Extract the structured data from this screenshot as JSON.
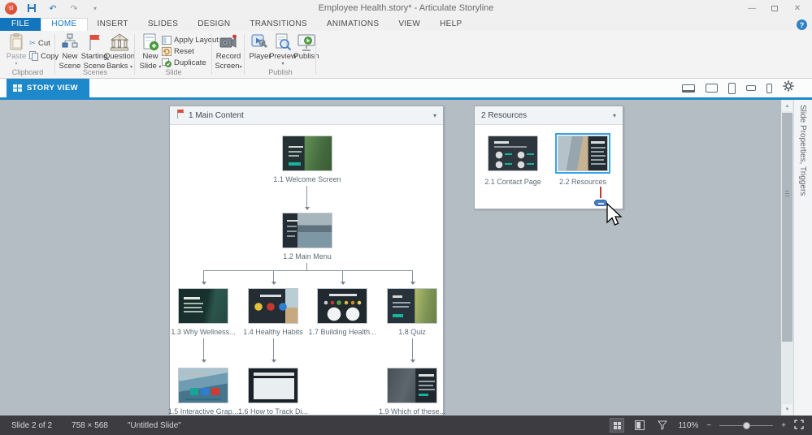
{
  "title_bar": {
    "title": "Employee Health.story* - Articulate Storyline"
  },
  "tabs": {
    "file": "FILE",
    "home": "HOME",
    "insert": "INSERT",
    "slides": "SLIDES",
    "design": "DESIGN",
    "transitions": "TRANSITIONS",
    "animations": "ANIMATIONS",
    "view": "VIEW",
    "help": "HELP"
  },
  "ribbon": {
    "paste": "Paste",
    "cut": "Cut",
    "copy": "Copy",
    "clipboard_group": "Clipboard",
    "new_scene": [
      "New",
      "Scene"
    ],
    "starting_scene": [
      "Starting",
      "Scene"
    ],
    "question_banks": [
      "Question",
      "Banks"
    ],
    "scenes_group": "Scenes",
    "new_slide": [
      "New",
      "Slide"
    ],
    "apply_layout": "Apply Layout",
    "reset": "Reset",
    "duplicate": "Duplicate",
    "record_screen": [
      "Record",
      "Screen"
    ],
    "slide_group": "Slide",
    "player": "Player",
    "preview": "Preview",
    "publish": "Publish",
    "publish_group": "Publish"
  },
  "view_tab": {
    "label": "STORY VIEW"
  },
  "scenes": [
    {
      "title": "1 Main Content",
      "slides": [
        {
          "label": "1.1 Welcome Screen"
        },
        {
          "label": "1.2 Main Menu"
        },
        {
          "label": "1.3 Why Wellness..."
        },
        {
          "label": "1.4 Healthy Habits"
        },
        {
          "label": "1.7 Building Health..."
        },
        {
          "label": "1.8 Quiz"
        },
        {
          "label": "1.5 Interactive Grap..."
        },
        {
          "label": "1.6 How to Track Di..."
        },
        {
          "label": "1.9 Which of these..."
        }
      ]
    },
    {
      "title": "2 Resources",
      "slides": [
        {
          "label": "2.1 Contact Page"
        },
        {
          "label": "2.2 Resources"
        }
      ]
    }
  ],
  "sidebar": {
    "label": "Slide Properties, Triggers"
  },
  "status_bar": {
    "slide_position": "Slide 2 of 2",
    "dimensions": "758 × 568",
    "slide_name": "\"Untitled Slide\"",
    "zoom_level": "110%"
  },
  "icons": {
    "help": "?",
    "chevron_down": "▾",
    "scroll_up": "▲",
    "scroll_down": "▼",
    "minimize": "—",
    "close": "✕",
    "cut_glyph": "✂"
  },
  "colors": {
    "accent": "#1d88ca",
    "selection": "#35a3e8",
    "starting_flag": "#e04b3a",
    "insertion_line": "#c33a2c"
  }
}
